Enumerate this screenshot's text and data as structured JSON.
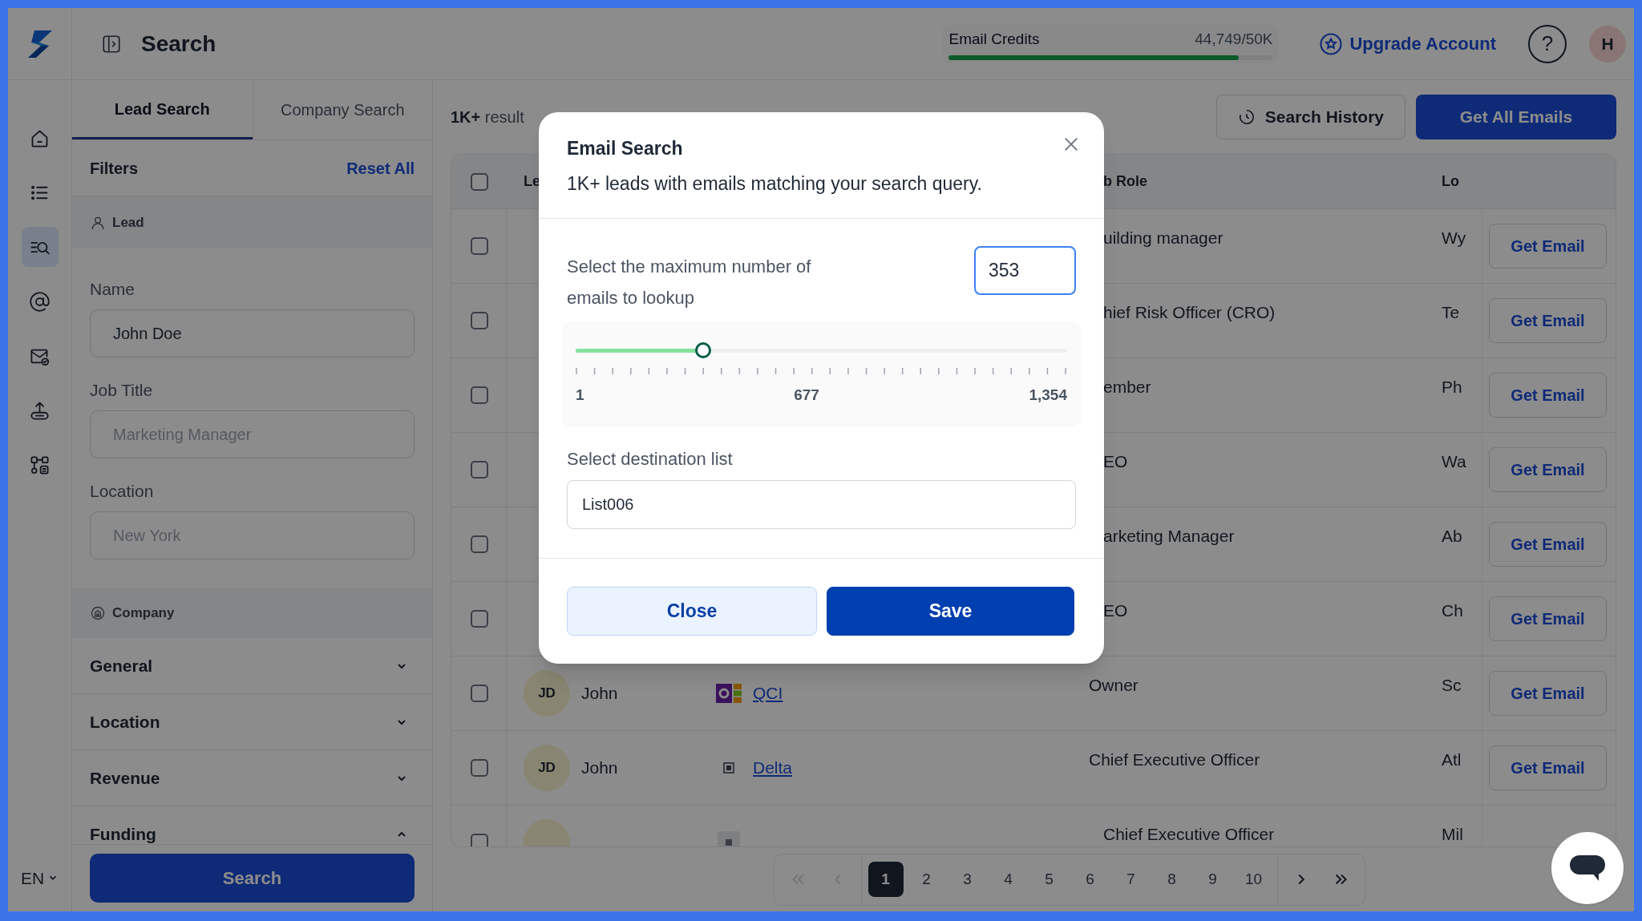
{
  "header": {
    "title": "Search",
    "credits": {
      "label": "Email Credits",
      "reading": "44,749/50K",
      "level": 0.895
    },
    "upgrade": "Upgrade Account",
    "help": "?",
    "avatar": "H"
  },
  "rail": {
    "items": [
      {
        "kind": "home",
        "selected": false
      },
      {
        "kind": "list",
        "selected": false
      },
      {
        "kind": "search",
        "selected": true
      },
      {
        "kind": "at",
        "selected": false
      },
      {
        "kind": "mail",
        "selected": false
      },
      {
        "kind": "upload",
        "selected": false
      },
      {
        "kind": "flow",
        "selected": false
      }
    ],
    "language": "EN"
  },
  "filters": {
    "tabs": [
      {
        "label": "Lead Search",
        "selected": true
      },
      {
        "label": "Company Search",
        "selected": false
      }
    ],
    "title": "Filters",
    "reset": "Reset All",
    "lead": {
      "label": "Lead",
      "fields": [
        {
          "label": "Name",
          "value": "John Doe"
        },
        {
          "label": "Job Title",
          "placeholder": "Marketing Manager"
        },
        {
          "label": "Location",
          "placeholder": "New York"
        }
      ]
    },
    "company": {
      "label": "Company",
      "groups": [
        {
          "label": "General",
          "expanded": false
        },
        {
          "label": "Location",
          "expanded": false
        },
        {
          "label": "Revenue",
          "expanded": false
        },
        {
          "label": "Funding",
          "expanded": true
        }
      ]
    },
    "search_button": "Search"
  },
  "results": {
    "count": "1K+",
    "label": "result"
  },
  "toolbar": {
    "history": "Search History",
    "get_all": "Get All Emails"
  },
  "table": {
    "select_all_checked": false,
    "columns": [
      "Le",
      "b Role",
      "Lo"
    ],
    "rows": [
      {
        "checked": false,
        "job_role": "uilding manager",
        "location": "Wy",
        "action": "Get Email"
      },
      {
        "checked": false,
        "job_role": "hief Risk Officer (CRO)",
        "location": "Te",
        "action": "Get Email"
      },
      {
        "checked": false,
        "job_role": "ember",
        "location": "Ph",
        "action": "Get Email"
      },
      {
        "checked": false,
        "job_role": "EO",
        "location": "Wa",
        "action": "Get Email"
      },
      {
        "checked": false,
        "job_role": "arketing Manager",
        "location": "Ab",
        "action": "Get Email"
      },
      {
        "checked": false,
        "job_role": "EO",
        "location": "Ch",
        "action": "Get Email"
      },
      {
        "checked": false,
        "initials": "JD",
        "name": "John",
        "company": "QCI",
        "job_role": "Owner",
        "location": "Sc",
        "action": "Get Email"
      },
      {
        "checked": false,
        "initials": "JD",
        "name": "John",
        "company": "Delta",
        "job_role": "Chief Executive Officer",
        "location": "Atl",
        "action": "Get Email"
      },
      {
        "checked": false,
        "job_role": "Chief Executive Officer",
        "location": "Mil"
      }
    ]
  },
  "pagination": {
    "first_disabled": true,
    "prev_disabled": true,
    "next_disabled": false,
    "last_disabled": false,
    "pages": [
      {
        "label": "1",
        "selected": true
      },
      {
        "label": "2",
        "selected": false
      },
      {
        "label": "3",
        "selected": false
      },
      {
        "label": "4",
        "selected": false
      },
      {
        "label": "5",
        "selected": false
      },
      {
        "label": "6",
        "selected": false
      },
      {
        "label": "7",
        "selected": false
      },
      {
        "label": "8",
        "selected": false
      },
      {
        "label": "9",
        "selected": false
      },
      {
        "label": "10",
        "selected": false
      }
    ]
  },
  "modal": {
    "title": "Email Search",
    "subtitle": "1K+ leads with emails matching your search query.",
    "max_label": "Select the maximum number of emails to lookup",
    "max_value": "353",
    "slider": {
      "level": 0.26,
      "labels": [
        "1",
        "677",
        "1,354"
      ]
    },
    "list_label": "Select destination list",
    "list_value": "List006",
    "buttons": [
      {
        "label": "Close",
        "kind": "secondary"
      },
      {
        "label": "Save",
        "kind": "primary"
      }
    ]
  }
}
